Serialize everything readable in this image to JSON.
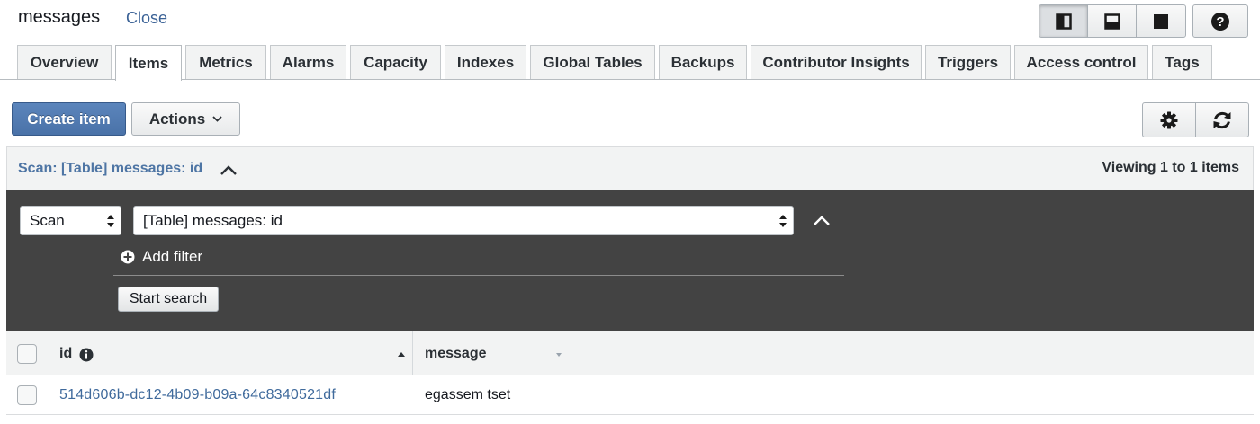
{
  "header": {
    "title": "messages",
    "close_label": "Close"
  },
  "layout_buttons": {
    "icons": [
      "split-right-icon",
      "split-bottom-icon",
      "full-screen-icon"
    ],
    "active": "split-right-icon"
  },
  "help": {
    "icon": "help-icon"
  },
  "tabs": [
    {
      "label": "Overview"
    },
    {
      "label": "Items",
      "active": true
    },
    {
      "label": "Metrics"
    },
    {
      "label": "Alarms"
    },
    {
      "label": "Capacity"
    },
    {
      "label": "Indexes"
    },
    {
      "label": "Global Tables"
    },
    {
      "label": "Backups"
    },
    {
      "label": "Contributor Insights"
    },
    {
      "label": "Triggers"
    },
    {
      "label": "Access control"
    },
    {
      "label": "Tags"
    }
  ],
  "toolbar": {
    "create_label": "Create item",
    "actions_label": "Actions",
    "settings_icon": "gear-icon",
    "refresh_icon": "refresh-icon"
  },
  "scan": {
    "summary": "Scan: [Table] messages: id",
    "viewing": "Viewing 1 to 1 items"
  },
  "query": {
    "operation": "Scan",
    "target": "[Table] messages: id",
    "add_filter_label": "Add filter",
    "start_label": "Start search"
  },
  "table": {
    "columns": [
      "id",
      "message"
    ],
    "rows": [
      {
        "id": "514d606b-dc12-4b09-b09a-64c8340521df",
        "message": "egassem tset"
      }
    ]
  },
  "colors": {
    "primary": "#4a72a8",
    "link": "#3f6a9c",
    "panel": "#434343"
  }
}
